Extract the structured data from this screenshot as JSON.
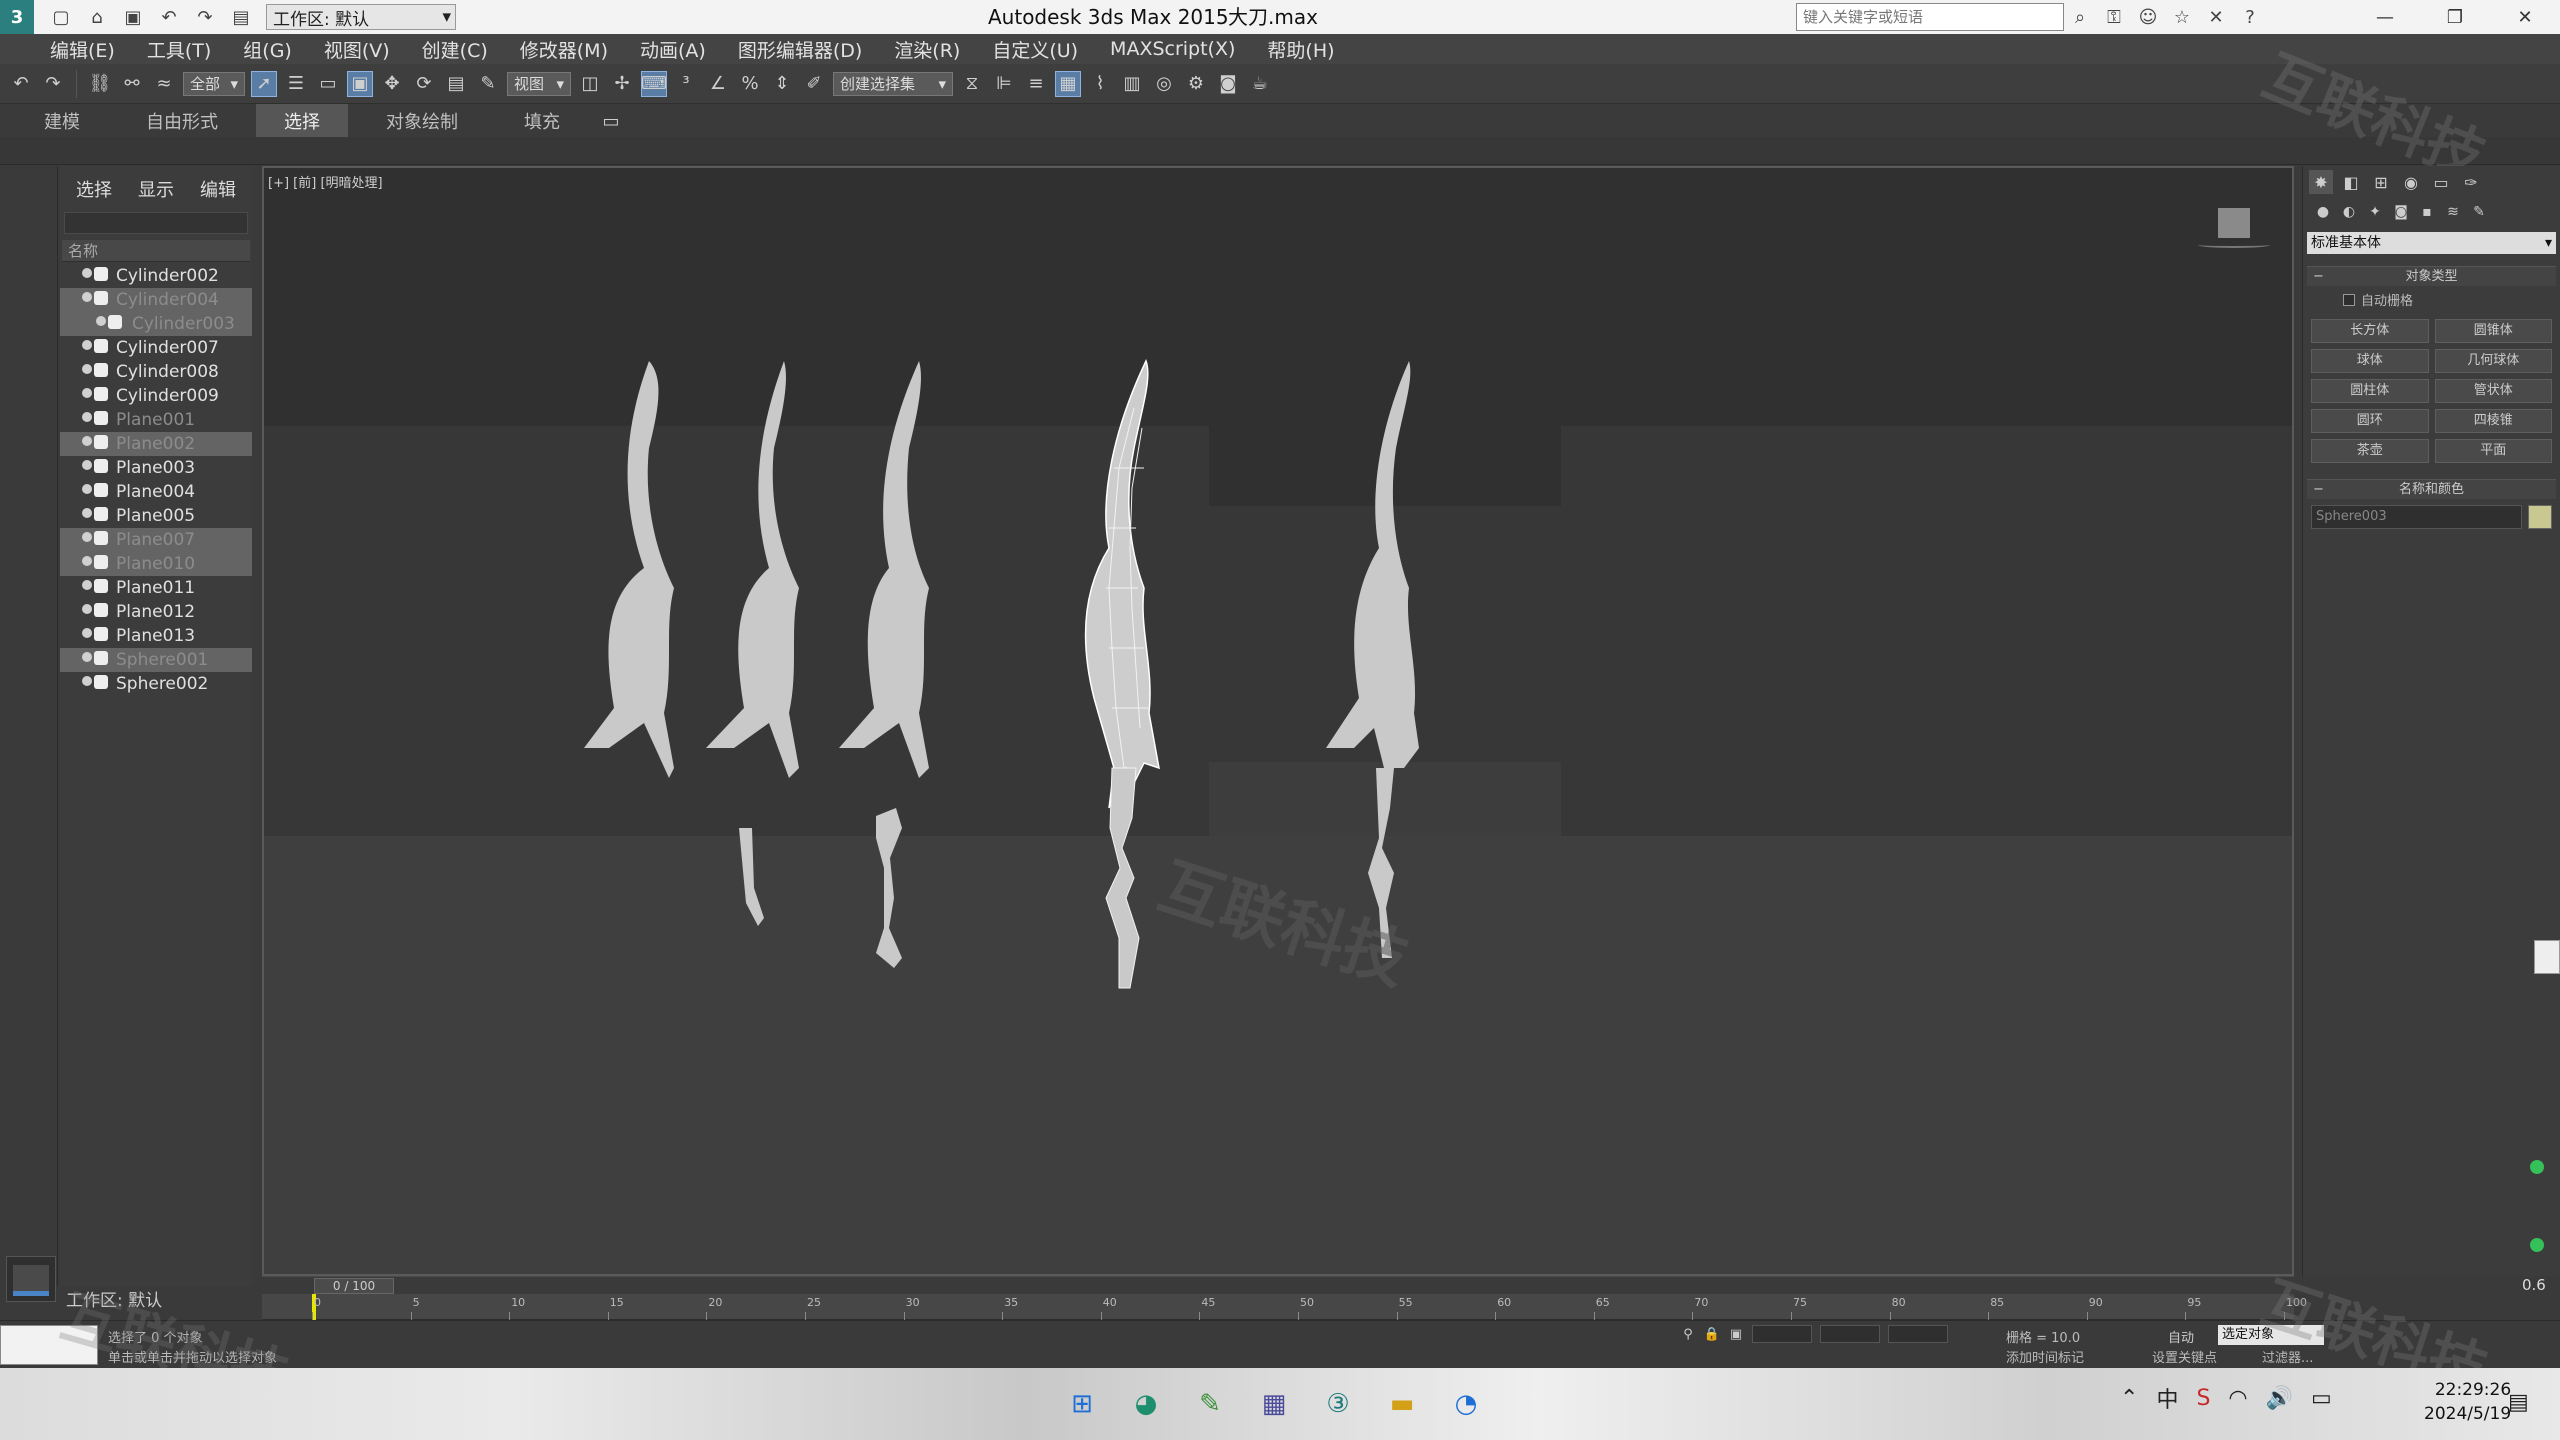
{
  "titlebar": {
    "logo": "3",
    "workspace": "工作区: 默认",
    "app_title": "Autodesk 3ds Max  2015",
    "file_name": "大刀.max",
    "search_placeholder": "键入关键字或短语",
    "window_controls": [
      "—",
      "❐",
      "✕"
    ]
  },
  "menu": [
    "编辑(E)",
    "工具(T)",
    "组(G)",
    "视图(V)",
    "创建(C)",
    "修改器(M)",
    "动画(A)",
    "图形编辑器(D)",
    "渲染(R)",
    "自定义(U)",
    "MAXScript(X)",
    "帮助(H)"
  ],
  "toolbar": {
    "selection_filter": "全部",
    "ref_coord": "视图",
    "named_selection": "创建选择集"
  },
  "ribbon_tabs": [
    "建模",
    "自由形式",
    "选择",
    "对象绘制",
    "填充"
  ],
  "explorer": {
    "tabs": [
      "选择",
      "显示",
      "编辑"
    ],
    "column_header": "名称",
    "objects": [
      {
        "name": "Cylinder002",
        "selected": false,
        "hidden": false,
        "child": false
      },
      {
        "name": "Cylinder004",
        "selected": true,
        "hidden": true,
        "child": false
      },
      {
        "name": "Cylinder003",
        "selected": true,
        "hidden": true,
        "child": true
      },
      {
        "name": "Cylinder007",
        "selected": false,
        "hidden": false,
        "child": false
      },
      {
        "name": "Cylinder008",
        "selected": false,
        "hidden": false,
        "child": false
      },
      {
        "name": "Cylinder009",
        "selected": false,
        "hidden": false,
        "child": false
      },
      {
        "name": "Plane001",
        "selected": false,
        "hidden": true,
        "child": false
      },
      {
        "name": "Plane002",
        "selected": true,
        "hidden": true,
        "child": false
      },
      {
        "name": "Plane003",
        "selected": false,
        "hidden": false,
        "child": false
      },
      {
        "name": "Plane004",
        "selected": false,
        "hidden": false,
        "child": false
      },
      {
        "name": "Plane005",
        "selected": false,
        "hidden": false,
        "child": false
      },
      {
        "name": "Plane007",
        "selected": true,
        "hidden": true,
        "child": false
      },
      {
        "name": "Plane010",
        "selected": true,
        "hidden": true,
        "child": false
      },
      {
        "name": "Plane011",
        "selected": false,
        "hidden": false,
        "child": false
      },
      {
        "name": "Plane012",
        "selected": false,
        "hidden": false,
        "child": false
      },
      {
        "name": "Plane013",
        "selected": false,
        "hidden": false,
        "child": false
      },
      {
        "name": "Sphere001",
        "selected": true,
        "hidden": true,
        "child": false
      },
      {
        "name": "Sphere002",
        "selected": false,
        "hidden": false,
        "child": false
      }
    ],
    "workspace_label": "工作区: 默认"
  },
  "viewport": {
    "label": "[+] [前] [明暗处理]",
    "watermark": "互联科技"
  },
  "command_panel": {
    "category": "标准基本体",
    "rollout_object_type": "对象类型",
    "autogrid": "自动栅格",
    "object_buttons": [
      "长方体",
      "圆锥体",
      "球体",
      "几何球体",
      "圆柱体",
      "管状体",
      "圆环",
      "四棱锥",
      "茶壶",
      "平面"
    ],
    "rollout_name_color": "名称和颜色",
    "name_value": "Sphere003"
  },
  "timeline": {
    "frame_display": "0 / 100",
    "ticks": [
      "0",
      "5",
      "10",
      "15",
      "20",
      "25",
      "30",
      "35",
      "40",
      "45",
      "50",
      "55",
      "60",
      "65",
      "70",
      "75",
      "80",
      "85",
      "90",
      "95",
      "100"
    ]
  },
  "status": {
    "line1": "选择了 0 个对象",
    "line2": "单击或单击并拖动以选择对象",
    "grid": "栅格 = 10.0",
    "add_time_tag": "添加时间标记",
    "auto_key": "自动",
    "selection_set": "选定对象",
    "set_key": "设置关键点",
    "key_filters": "过滤器...",
    "zoom": "0.6"
  },
  "taskbar": {
    "time": "22:29:26",
    "date": "2024/5/19"
  },
  "colors": {
    "accent": "#5a7da6",
    "viewport_bg": "#3f3f3f",
    "mesh": "#c9c9c9",
    "status_green": "#35c05a",
    "playhead": "#e6e600"
  }
}
